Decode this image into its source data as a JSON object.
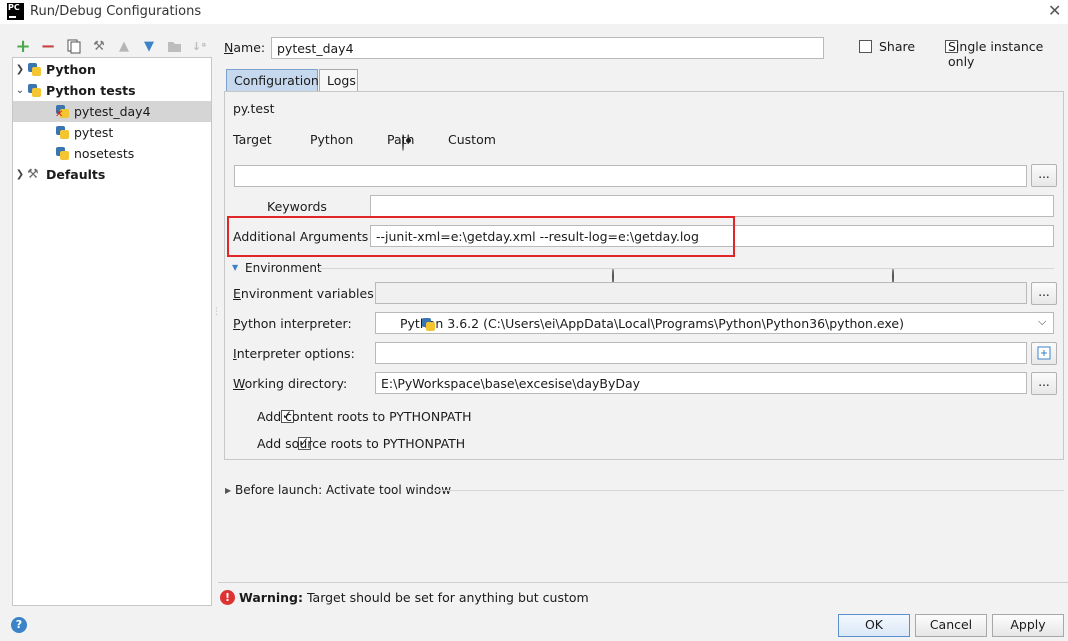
{
  "window": {
    "title": "Run/Debug Configurations",
    "app_icon_text": "PC"
  },
  "toolbar": {
    "icons": [
      "add-icon",
      "remove-icon",
      "copy-icon",
      "edit-defaults-icon",
      "move-up-icon",
      "move-down-icon",
      "folder-icon",
      "sort-icon"
    ]
  },
  "tree": {
    "python": "Python",
    "python_tests": "Python tests",
    "pytest_day4": "pytest_day4",
    "pytest": "pytest",
    "nosetests": "nosetests",
    "defaults": "Defaults"
  },
  "header": {
    "name_label": "Name:",
    "name_value": "pytest_day4",
    "share_label": "Share",
    "single_instance_label": "Single instance only"
  },
  "tabs": {
    "configuration": "Configuration",
    "logs": "Logs"
  },
  "config": {
    "runner": "py.test",
    "target_label": "Target",
    "target_options": {
      "python": "Python",
      "path": "Path",
      "custom": "Custom"
    },
    "target_selected": "Path",
    "target_value": "",
    "keywords_label": "Keywords",
    "keywords_value": "",
    "additional_args_label": "Additional Arguments",
    "additional_args_value": "--junit-xml=e:\\getday.xml --result-log=e:\\getday.log",
    "environment_label": "Environment",
    "env_vars_label": "Environment variables:",
    "env_vars_value": "",
    "interpreter_label": "Python interpreter:",
    "interpreter_value": "Python 3.6.2 (C:\\Users\\ei\\AppData\\Local\\Programs\\Python\\Python36\\python.exe)",
    "interp_options_label": "Interpreter options:",
    "interp_options_value": "",
    "working_dir_label": "Working directory:",
    "working_dir_value": "E:\\PyWorkspace\\base\\excesise\\dayByDay",
    "content_roots_label": "Add content roots to PYTHONPATH",
    "source_roots_label": "Add source roots to PYTHONPATH",
    "browse_label": "..."
  },
  "before_launch": "Before launch: Activate tool window",
  "warning": {
    "bold": "Warning:",
    "text": "Target should be set for anything but custom"
  },
  "buttons": {
    "ok": "OK",
    "cancel": "Cancel",
    "apply": "Apply"
  },
  "colors": {
    "accent_tab": "#c6d8ee",
    "highlight_box": "#e02626",
    "add_green": "#4aa84a",
    "remove_red": "#c94040"
  }
}
